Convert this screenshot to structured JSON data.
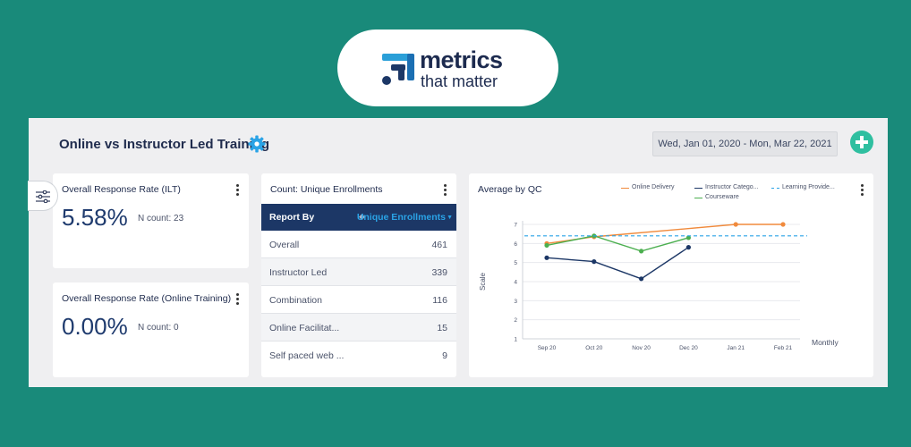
{
  "logo": {
    "word1": "metrics",
    "word2": "that matter"
  },
  "dashboard": {
    "title": "Online vs Instructor Led Training",
    "date_range": "Wed, Jan 01, 2020 - Mon, Mar 22, 2021"
  },
  "cards": {
    "ilt": {
      "title": "Overall Response Rate (ILT)",
      "value": "5.58%",
      "ncount": "N count: 23"
    },
    "online": {
      "title": "Overall Response Rate (Online Training)",
      "value": "0.00%",
      "ncount": "N count: 0"
    },
    "enrollments": {
      "title": "Count: Unique Enrollments",
      "headers": [
        "Report By",
        "Unique Enrollments"
      ],
      "rows": [
        {
          "label": "Overall",
          "value": "461"
        },
        {
          "label": "Instructor Led",
          "value": "339"
        },
        {
          "label": "Combination",
          "value": "116"
        },
        {
          "label": "Online Facilitat...",
          "value": "15"
        },
        {
          "label": "Self paced web ...",
          "value": "9"
        }
      ]
    }
  },
  "chart_data": {
    "type": "line",
    "title": "Average by QC",
    "xlabel": "Monthly",
    "ylabel": "Scale",
    "categories": [
      "Sep 20",
      "Oct 20",
      "Nov 20",
      "Dec 20",
      "Jan 21",
      "Feb 21"
    ],
    "y_ticks": [
      "1",
      "2",
      "3",
      "4",
      "5",
      "6",
      "7"
    ],
    "ylim": [
      1,
      7
    ],
    "grid": true,
    "legend_position": "top",
    "series": [
      {
        "name": "Online Delivery",
        "color": "#f08a3c",
        "values": [
          6.0,
          6.35,
          null,
          null,
          7.0,
          7.0
        ]
      },
      {
        "name": "Instructor Catego...",
        "color": "#1c3766",
        "values": [
          5.25,
          5.05,
          4.15,
          5.8,
          null,
          null
        ]
      },
      {
        "name": "Courseware",
        "color": "#4caf50",
        "values": [
          5.9,
          6.4,
          5.6,
          6.3,
          null,
          null
        ]
      },
      {
        "name": "Learning Provide...",
        "color": "#2aa3e6",
        "dashed": true,
        "values": [
          6.4,
          6.4,
          6.4,
          6.4,
          6.4,
          6.4
        ]
      }
    ]
  }
}
